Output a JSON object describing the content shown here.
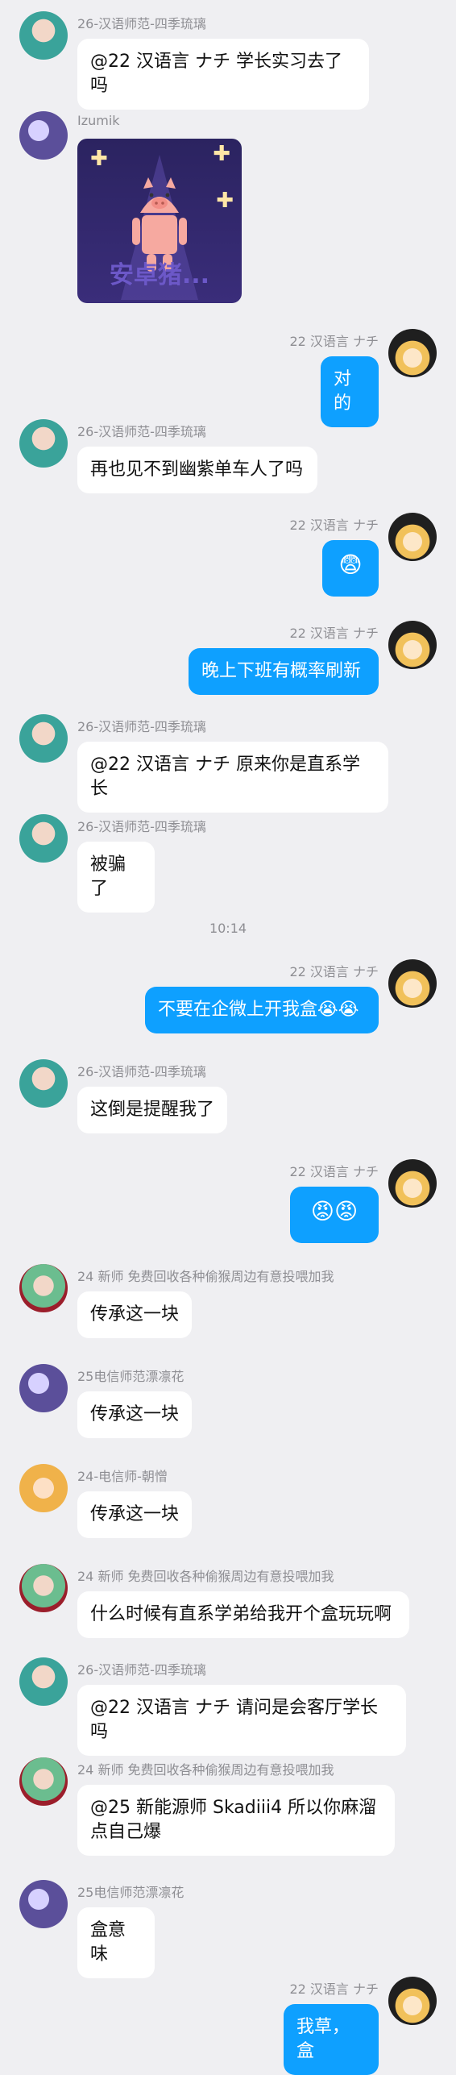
{
  "timestamp": "10:14",
  "messages": [
    {
      "side": "left",
      "sender": "26-汉语师范-四季琉璃",
      "text": "@22 汉语言 ナチ 学长实习去了吗",
      "avatar": "green-hair-avatar"
    },
    {
      "side": "left",
      "sender": "Izumik",
      "image_text": "安卓猪...",
      "avatar": "purple-anime-avatar"
    },
    {
      "side": "right",
      "sender": "22 汉语言 ナチ",
      "text": "对的",
      "avatar": "blonde-witch-avatar"
    },
    {
      "side": "left",
      "sender": "26-汉语师范-四季琉璃",
      "text": "再也见不到幽紫单车人了吗",
      "avatar": "green-hair-avatar"
    },
    {
      "side": "right",
      "sender": "22 汉语言 ナチ",
      "text": "😨",
      "avatar": "blonde-witch-avatar"
    },
    {
      "side": "right",
      "sender": "22 汉语言 ナチ",
      "text": "晚上下班有概率刷新",
      "avatar": "blonde-witch-avatar"
    },
    {
      "side": "left",
      "sender": "26-汉语师范-四季琉璃",
      "text": "@22 汉语言 ナチ 原来你是直系学长",
      "avatar": "green-hair-avatar"
    },
    {
      "side": "left",
      "sender": "26-汉语师范-四季琉璃",
      "text": "被骗了",
      "avatar": "green-hair-avatar"
    },
    {
      "side": "right",
      "sender": "22 汉语言 ナチ",
      "text": "不要在企微上开我盒😭😭",
      "avatar": "blonde-witch-avatar"
    },
    {
      "side": "left",
      "sender": "26-汉语师范-四季琉璃",
      "text": "这倒是提醒我了",
      "avatar": "green-hair-avatar"
    },
    {
      "side": "right",
      "sender": "22 汉语言 ナチ",
      "text": "😡😡",
      "avatar": "blonde-witch-avatar"
    },
    {
      "side": "left",
      "sender": "24 新师 免费回收各种偷猴周边有意投喂加我",
      "text": "传承这一块",
      "avatar": "green-hair-red-ribbon-avatar"
    },
    {
      "side": "left",
      "sender": "25电信师范漂凛花",
      "text": "传承这一块",
      "avatar": "purple-anime-avatar"
    },
    {
      "side": "left",
      "sender": "24-电信师-朝憎",
      "text": "传承这一块",
      "avatar": "fox-girl-avatar"
    },
    {
      "side": "left",
      "sender": "24 新师 免费回收各种偷猴周边有意投喂加我",
      "text": "什么时候有直系学弟给我开个盒玩玩啊",
      "avatar": "green-hair-red-ribbon-avatar"
    },
    {
      "side": "left",
      "sender": "26-汉语师范-四季琉璃",
      "text": "@22 汉语言 ナチ 请问是会客厅学长吗",
      "avatar": "green-hair-avatar"
    },
    {
      "side": "left",
      "sender": "24 新师 免费回收各种偷猴周边有意投喂加我",
      "text": "@25 新能源师 Skadiii4 所以你麻溜点自己爆",
      "avatar": "green-hair-red-ribbon-avatar"
    },
    {
      "side": "left",
      "sender": "25电信师范漂凛花",
      "text": "盒意味",
      "avatar": "purple-anime-avatar"
    },
    {
      "side": "right",
      "sender": "22 汉语言 ナチ",
      "text": "我草，盒",
      "avatar": "blonde-witch-avatar"
    }
  ]
}
